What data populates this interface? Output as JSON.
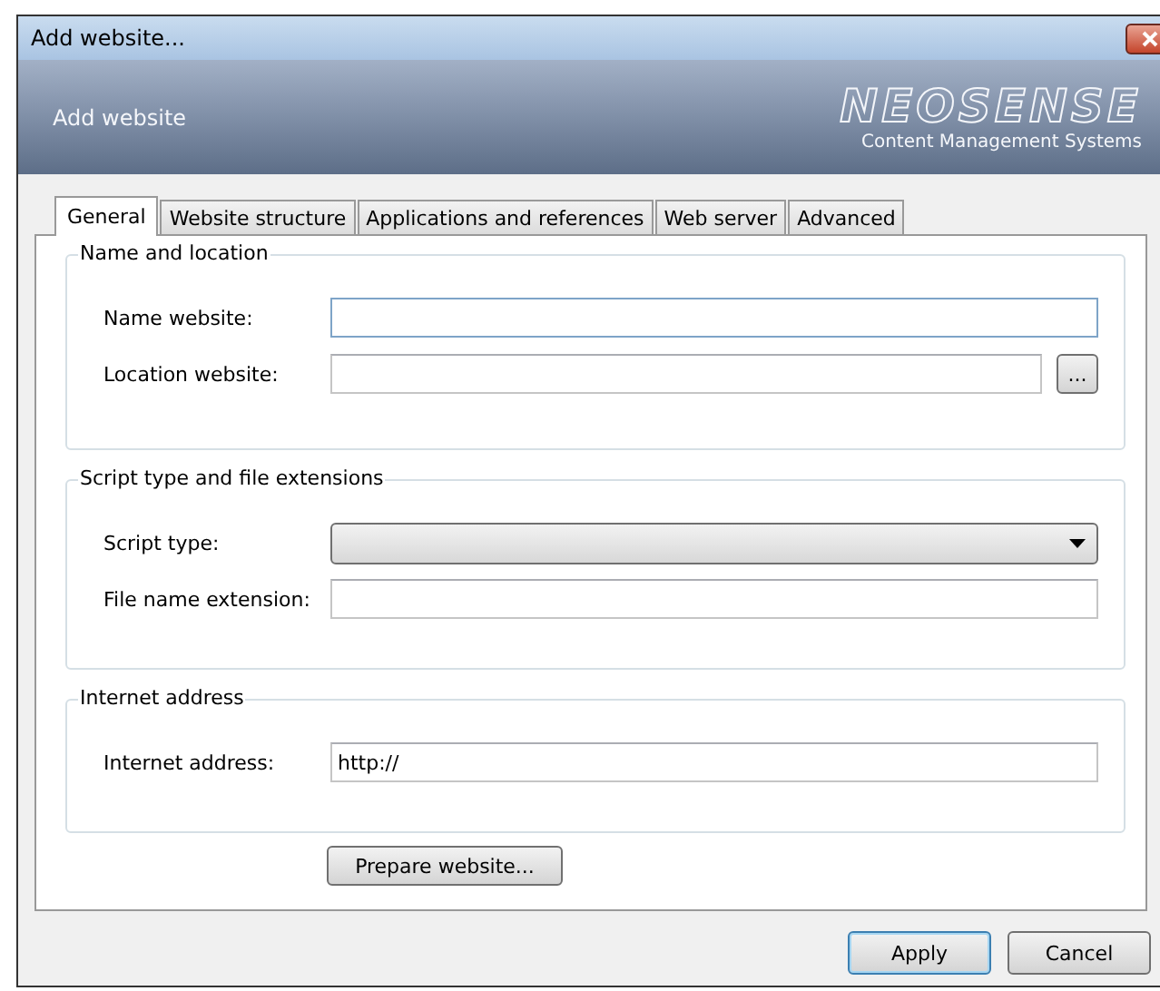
{
  "window": {
    "title": "Add website..."
  },
  "banner": {
    "heading": "Add website",
    "logo": "NEOSENSE",
    "tagline": "Content Management Systems"
  },
  "tabs": [
    {
      "label": "General",
      "selected": true
    },
    {
      "label": "Website structure",
      "selected": false
    },
    {
      "label": "Applications and references",
      "selected": false
    },
    {
      "label": "Web server",
      "selected": false
    },
    {
      "label": "Advanced",
      "selected": false
    }
  ],
  "groups": [
    {
      "title": "Name and location",
      "fields": [
        {
          "kind": "text",
          "label": "Name website:",
          "focused": true
        },
        {
          "kind": "browse",
          "label": "Location website:",
          "focused": false,
          "button": "..."
        }
      ]
    },
    {
      "title": "Script type and file extensions",
      "fields": [
        {
          "kind": "dropdown",
          "label": "Script type:",
          "focused": false
        },
        {
          "kind": "text",
          "label": "File name extension:",
          "focused": false
        }
      ]
    },
    {
      "title": "Internet address",
      "fields": [
        {
          "kind": "text",
          "label": "Internet address:",
          "value": "http://",
          "focused": false
        }
      ]
    }
  ],
  "prepare_button": "Prepare website...",
  "buttons": [
    {
      "label": "Apply",
      "default": true
    },
    {
      "label": "Cancel",
      "default": false
    }
  ]
}
